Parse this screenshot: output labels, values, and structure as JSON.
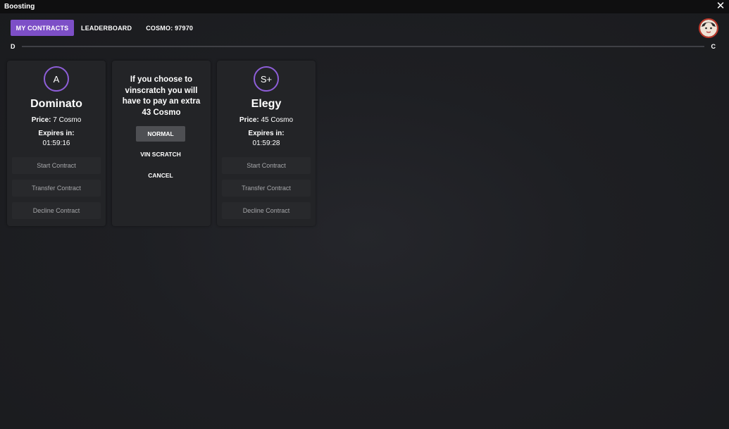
{
  "window": {
    "title": "Boosting",
    "close_glyph": "✕"
  },
  "nav": {
    "my_contracts": "MY CONTRACTS",
    "leaderboard": "LEADERBOARD",
    "cosmo_label": "COSMO: 97970"
  },
  "progress": {
    "left_label": "D",
    "right_label": "C",
    "fill_fraction": 0.0
  },
  "contracts": [
    {
      "tier": "A",
      "car": "Dominato",
      "price_label": "Price:",
      "price_value": " 7 Cosmo",
      "expires_label": "Expires in:",
      "expires_time": "01:59:16",
      "buttons": [
        "Start Contract",
        "Transfer Contract",
        "Decline Contract"
      ]
    },
    {
      "tier": "S+",
      "car": "Elegy",
      "price_label": "Price:",
      "price_value": " 45 Cosmo",
      "expires_label": "Expires in:",
      "expires_time": "01:59:28",
      "buttons": [
        "Start Contract",
        "Transfer Contract",
        "Decline Contract"
      ]
    }
  ],
  "prompt": {
    "message": "If you choose to vinscratch you will have to pay an extra 43 Cosmo",
    "options": [
      "NORMAL",
      "VIN SCRATCH",
      "CANCEL"
    ],
    "selected": "NORMAL"
  },
  "colors": {
    "accent": "#7d4fc7",
    "tier_ring": "#8e5ed9",
    "avatar_ring": "#c0392b"
  },
  "icons": {
    "close": "close-icon",
    "avatar": "avatar-icon"
  }
}
